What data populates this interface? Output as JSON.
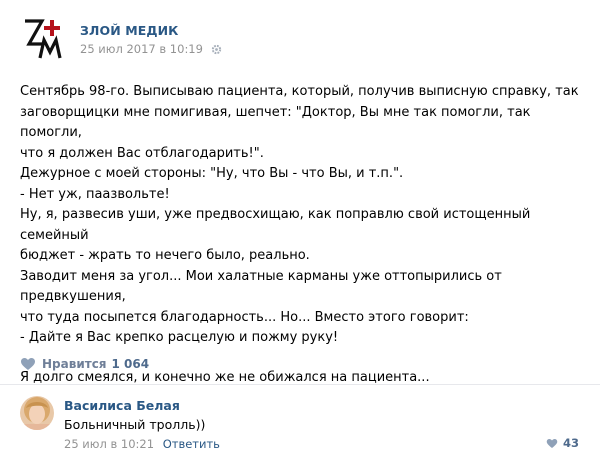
{
  "post": {
    "author": "ЗЛОЙ МЕДИК",
    "date": "25 июл 2017 в 10:19",
    "logo_icon": "zm-logo-icon",
    "paragraphs": [
      "Сентябрь 98-го. Выписываю пациента, который, получив выписную справку, так",
      "заговорщицки мне помигивая, шепчет: \"Доктор, Вы мне так помогли, так помогли,",
      "что я должен Вас отблагодарить!\".",
      "Дежурное с моей стороны: \"Ну, что Вы - что Вы, и т.п.\".",
      "- Нет уж, паазвольте!",
      "Ну, я, развесив уши, уже предвосхищаю, как поправлю свой истощенный семейный",
      "бюджет - жрать то нечего было, реально.",
      "Заводит меня за угол... Мои халатные карманы уже оттопырились от предвкушения,",
      "что туда посыпется благодарность... Но... Вместо этого говорит:",
      "- Дайте я Вас крепко расцелую и пожму руку!",
      "Я долго смеялся, и конечно же не обижался на пациента..."
    ]
  },
  "actions": {
    "like_label": "Нравится",
    "like_count": "1 064"
  },
  "comment": {
    "author": "Василиса Белая",
    "text": "Больничный тролль))",
    "date": "25 июл в 10:21",
    "reply_label": "Ответить",
    "likes": "43"
  },
  "colors": {
    "link": "#2a5885",
    "meta": "#939393",
    "accent": "#6f7f98",
    "logo_red": "#b5121b"
  }
}
